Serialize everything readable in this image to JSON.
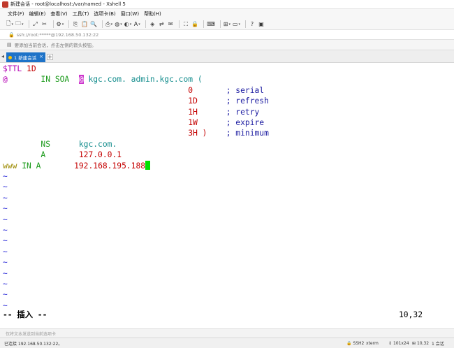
{
  "window": {
    "title": "新建会话 - root@localhost:/var/named - Xshell 5"
  },
  "menu": [
    "文件(F)",
    "编辑(E)",
    "查看(V)",
    "工具(T)",
    "选项卡(B)",
    "窗口(W)",
    "帮助(H)"
  ],
  "address": {
    "text": "ssh://root:*****@192.168.50.132:22"
  },
  "hint": {
    "text": "要添加当前会话，点击左侧的箭头按钮。"
  },
  "tabs": [
    {
      "label": "1 新建会话",
      "active": true
    }
  ],
  "tab_add": "+",
  "tab_close": "×",
  "terminal": {
    "line1": {
      "a": "$TTL",
      "b": " 1D"
    },
    "line2": {
      "at": "@",
      "gap1": "       ",
      "insoa": "IN SOA",
      "gap2": "  ",
      "at2": "@",
      "rest": " kgc.com. admin.kgc.com ("
    },
    "soa": [
      {
        "num": "0",
        "comment": "; serial"
      },
      {
        "num": "1D",
        "comment": "; refresh"
      },
      {
        "num": "1H",
        "comment": "; retry"
      },
      {
        "num": "1W",
        "comment": "; expire"
      },
      {
        "num": "3H )",
        "comment": "; minimum"
      }
    ],
    "ns": {
      "type": "NS",
      "value": "kgc.com."
    },
    "a1": {
      "type": "A",
      "value": "127.0.0.1"
    },
    "www": {
      "name": "www",
      "in": "IN",
      "type": "A",
      "value": "192.168.195.188"
    },
    "tilde": "~",
    "status": "-- 插入 --",
    "position": "10,32"
  },
  "sendbar": {
    "text": "仅将文本发送到当前选项卡"
  },
  "statusbar": {
    "connection": "已连接 192.168.50.132:22。",
    "protocol": "SSH2",
    "term": "xterm",
    "size": "101x24",
    "cursor": "10,32",
    "sessions": "1 会话"
  },
  "colors": {
    "tab_active": "#1e73c8",
    "cursor": "#00e000"
  }
}
